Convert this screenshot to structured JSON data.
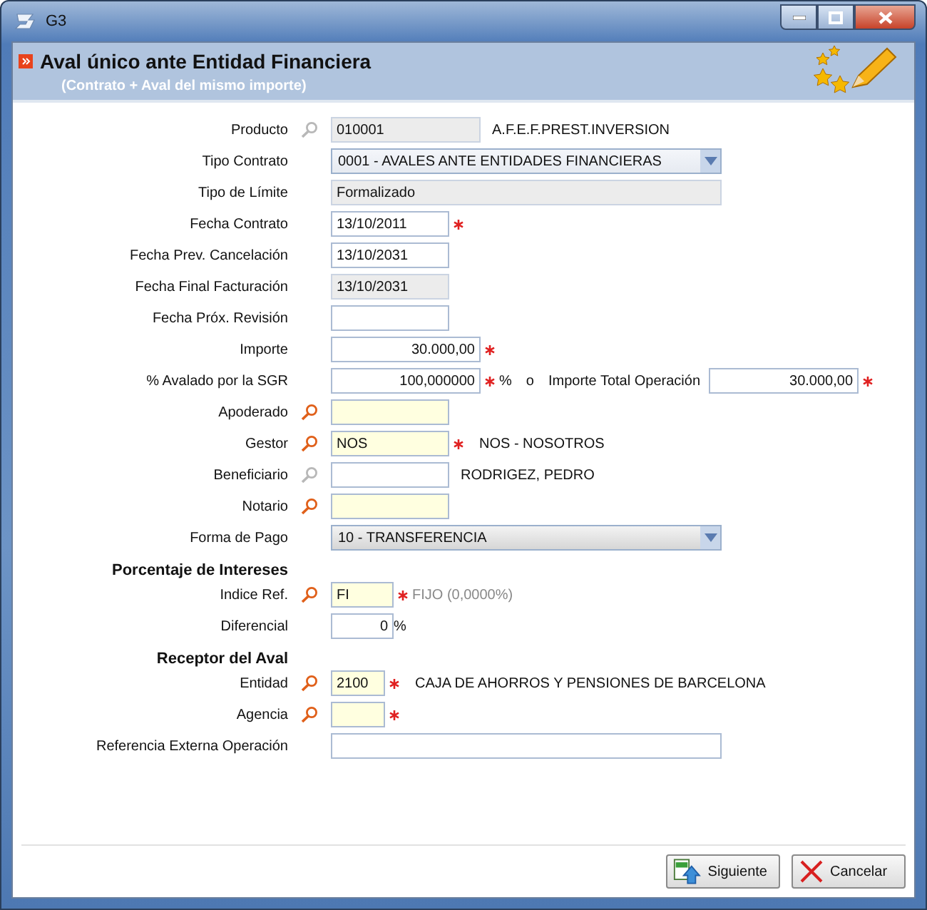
{
  "window": {
    "title": "G3"
  },
  "header": {
    "title": "Aval único ante Entidad Financiera",
    "subtitle": "(Contrato + Aval del mismo importe)"
  },
  "form": [
    {
      "kind": "text",
      "label": "Producto",
      "lookup": true,
      "lookup_disabled": true,
      "value": "010001",
      "readonly": true,
      "aside": "A.F.E.F.PREST.INVERSION"
    },
    {
      "kind": "select",
      "label": "Tipo Contrato",
      "value": "0001 - AVALES ANTE ENTIDADES FINANCIERAS"
    },
    {
      "kind": "wide",
      "label": "Tipo de Límite",
      "value": "Formalizado",
      "readonly": true
    },
    {
      "kind": "date",
      "label": "Fecha Contrato",
      "value": "13/10/2011",
      "required": true
    },
    {
      "kind": "date",
      "label": "Fecha Prev. Cancelación",
      "value": "13/10/2031"
    },
    {
      "kind": "date",
      "label": "Fecha Final Facturación",
      "value": "13/10/2031",
      "readonly": true
    },
    {
      "kind": "date",
      "label": "Fecha Próx. Revisión"
    },
    {
      "kind": "text",
      "label": "Importe",
      "value": "30.000,00",
      "numeric": true,
      "required": true
    },
    {
      "kind": "text",
      "label": "% Avalado por la SGR",
      "value": "100,000000",
      "numeric": true,
      "required": true,
      "suffix": "%",
      "extra": {
        "conjunction": "o",
        "label": "Importe Total Operación",
        "value": "30.000,00",
        "numeric": true,
        "required": true
      }
    },
    {
      "kind": "date",
      "label": "Apoderado",
      "lookup": true,
      "highlighted": true
    },
    {
      "kind": "date",
      "label": "Gestor",
      "lookup": true,
      "highlighted": true,
      "value": "NOS",
      "required": true,
      "aside": "NOS - NOSOTROS"
    },
    {
      "kind": "date",
      "label": "Beneficiario",
      "lookup": true,
      "lookup_disabled": true,
      "aside": "RODRIGEZ, PEDRO"
    },
    {
      "kind": "date",
      "label": "Notario",
      "lookup": true,
      "highlighted": true
    },
    {
      "kind": "select",
      "label": "Forma de Pago",
      "value": "10 - TRANSFERENCIA",
      "readonly": true
    },
    {
      "kind": "heading",
      "label": "Porcentaje de Intereses"
    },
    {
      "kind": "short",
      "label": "Indice Ref.",
      "lookup": true,
      "highlighted": true,
      "value": "FI",
      "required": true,
      "aside": "FIJO (0,0000%)",
      "aside_dim": true
    },
    {
      "kind": "short",
      "label": "Diferencial",
      "value": "0",
      "numeric": true,
      "suffix": "%"
    },
    {
      "kind": "heading",
      "label": "Receptor del Aval"
    },
    {
      "kind": "code",
      "label": "Entidad",
      "lookup": true,
      "highlighted": true,
      "value": "2100",
      "required": true,
      "aside": "CAJA DE AHORROS Y PENSIONES DE BARCELONA"
    },
    {
      "kind": "code",
      "label": "Agencia",
      "lookup": true,
      "highlighted": true,
      "required": true
    },
    {
      "kind": "wide",
      "label": "Referencia Externa Operación"
    }
  ],
  "buttons": [
    {
      "kind": "next",
      "label": "Siguiente"
    },
    {
      "kind": "cancel",
      "label": "Cancelar"
    }
  ]
}
